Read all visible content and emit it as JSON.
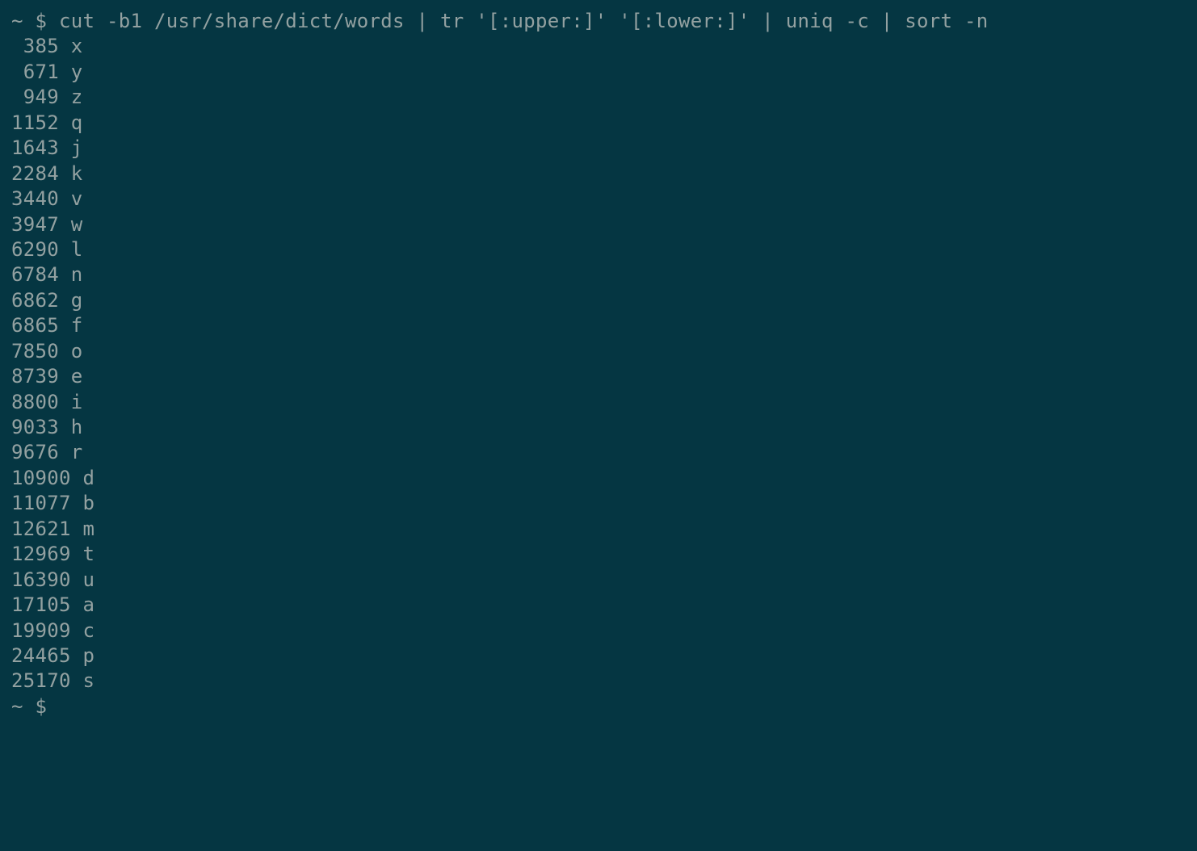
{
  "prompt": {
    "tilde": "~",
    "dollar": "$",
    "command": "cut -b1 /usr/share/dict/words | tr '[:upper:]' '[:lower:]' | uniq -c | sort -n"
  },
  "output": [
    {
      "count": "385",
      "letter": "x"
    },
    {
      "count": "671",
      "letter": "y"
    },
    {
      "count": "949",
      "letter": "z"
    },
    {
      "count": "1152",
      "letter": "q"
    },
    {
      "count": "1643",
      "letter": "j"
    },
    {
      "count": "2284",
      "letter": "k"
    },
    {
      "count": "3440",
      "letter": "v"
    },
    {
      "count": "3947",
      "letter": "w"
    },
    {
      "count": "6290",
      "letter": "l"
    },
    {
      "count": "6784",
      "letter": "n"
    },
    {
      "count": "6862",
      "letter": "g"
    },
    {
      "count": "6865",
      "letter": "f"
    },
    {
      "count": "7850",
      "letter": "o"
    },
    {
      "count": "8739",
      "letter": "e"
    },
    {
      "count": "8800",
      "letter": "i"
    },
    {
      "count": "9033",
      "letter": "h"
    },
    {
      "count": "9676",
      "letter": "r"
    },
    {
      "count": "10900",
      "letter": "d"
    },
    {
      "count": "11077",
      "letter": "b"
    },
    {
      "count": "12621",
      "letter": "m"
    },
    {
      "count": "12969",
      "letter": "t"
    },
    {
      "count": "16390",
      "letter": "u"
    },
    {
      "count": "17105",
      "letter": "a"
    },
    {
      "count": "19909",
      "letter": "c"
    },
    {
      "count": "24465",
      "letter": "p"
    },
    {
      "count": "25170",
      "letter": "s"
    }
  ],
  "prompt2": {
    "tilde": "~",
    "dollar": "$"
  }
}
